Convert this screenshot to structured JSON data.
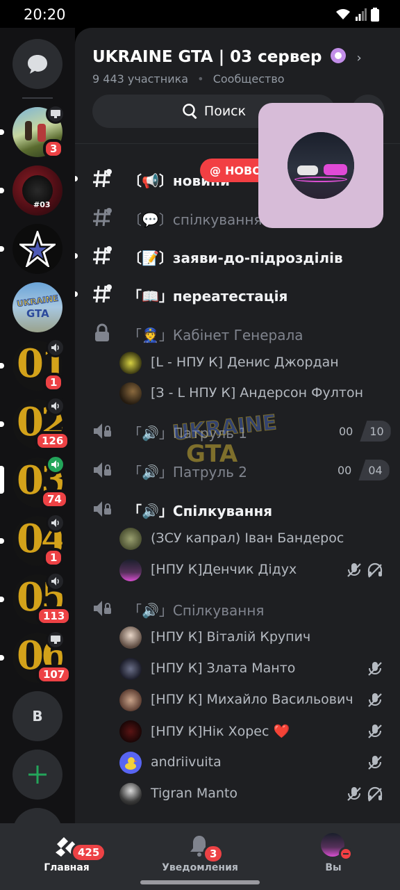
{
  "status_bar": {
    "time": "20:20"
  },
  "server": {
    "name": "UKRAINE GTA | 03 сервер",
    "members": "9 443 участника",
    "separator": "•",
    "type": "Сообщество",
    "chevron": "›"
  },
  "search": {
    "label": "Поиск"
  },
  "new_pill": {
    "label": "НОВО"
  },
  "rail": {
    "add_server_icon": "plus-icon",
    "dm_icon": "chat-bubble-icon",
    "letter_server": "B",
    "servers": [
      {
        "badge": "3",
        "activity_icon": "screen-share-icon"
      },
      {
        "badge": "",
        "tag": "#03"
      },
      {
        "badge": ""
      },
      {
        "badge": "",
        "logo_text_top": "UKRAINE",
        "logo_text_bottom": "GTA"
      },
      {
        "badge": "1",
        "gold_number": "01",
        "activity_icon": "speaker-icon"
      },
      {
        "badge": "126",
        "gold_number": "02",
        "activity_icon": "speaker-icon"
      },
      {
        "badge": "74",
        "gold_number": "03",
        "activity_icon": "speaker-icon"
      },
      {
        "badge": "1",
        "gold_number": "04",
        "activity_icon": "speaker-icon"
      },
      {
        "badge": "113",
        "gold_number": "05",
        "activity_icon": "speaker-icon"
      },
      {
        "badge": "107",
        "gold_number": "06",
        "activity_icon": "screen-share-icon"
      }
    ]
  },
  "channels": {
    "c1": "〔📢〕новини",
    "c2": "〔💬〕спілкування",
    "c3": "〔📝〕заяви-до-підрозділів",
    "c4": "「📖」переатестація",
    "c5": "「👮」Кабінет Генерала",
    "c6": "「🔊」Патруль 1",
    "c7": "「🔊」Патруль 2",
    "c8": "「🔊」Спілкування",
    "c9": "「🔊」Спілкування"
  },
  "counters": {
    "patrol1_a": "00",
    "patrol1_b": "10",
    "patrol2_a": "00",
    "patrol2_b": "04"
  },
  "members": {
    "m1": "[L - НПУ К] Денис Джордан",
    "m2": "[З - L НПУ К] Андерсон Фултон",
    "m3": "(ЗСУ капрал) Іван Бандерос",
    "m4": "[НПУ К]Денчик Дідух",
    "m5": "[НПУ К] Віталій Крупич",
    "m6": "[НПУ К] Злата Манто",
    "m7": "[НПУ К] Михайло Васильович",
    "m8": "[НПУ К]Нік Хорес ❤️",
    "m9": "andriivuita",
    "m10": "Tigran Manto"
  },
  "watermark": {
    "top": "UKRAINE",
    "bottom": "GTA"
  },
  "bottom_nav": {
    "home": {
      "label": "Главная",
      "badge": "425"
    },
    "notifications": {
      "label": "Уведомления",
      "badge": "3"
    },
    "you": {
      "label": "Вы"
    }
  },
  "colors": {
    "accent_red": "#f23f43",
    "online_green": "#23a55a",
    "popup_bg": "#d7bcd8"
  }
}
